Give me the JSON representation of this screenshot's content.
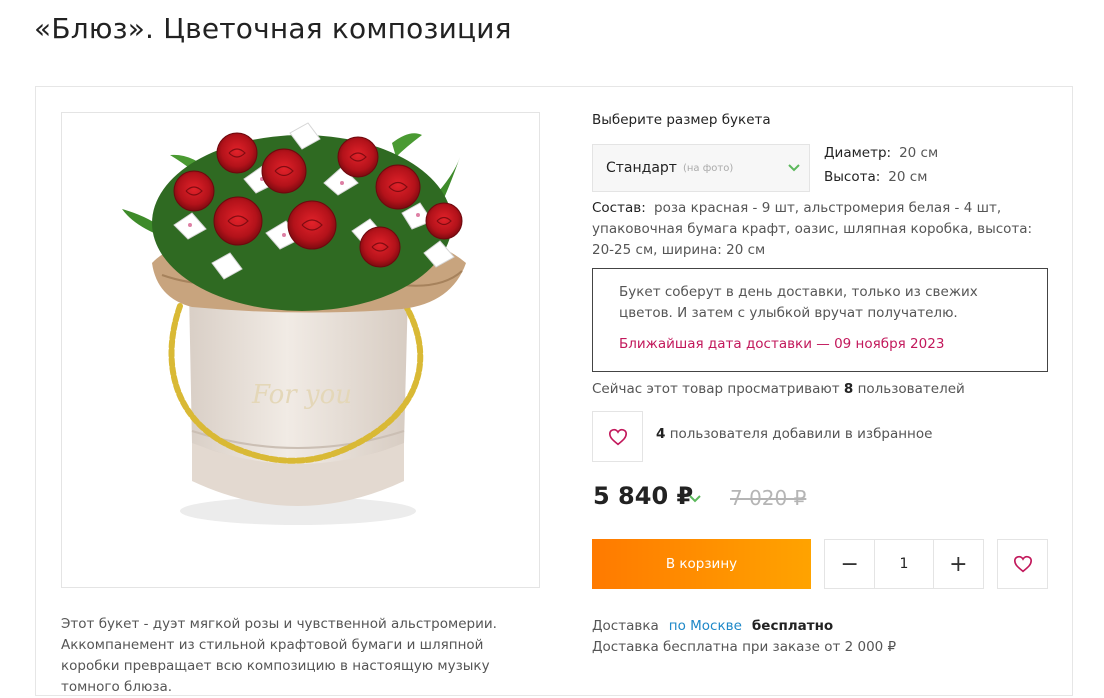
{
  "product": {
    "title": "«Блюз». Цветочная композиция",
    "description": "Этот букет - дуэт мягкой розы и чувственной альстромерии. Аккомпанемент из стильной крафтовой бумаги и шляпной коробки превращает всю композицию в настоящую музыку томного блюза.",
    "photo_lettering": "For you"
  },
  "size": {
    "title": "Выберите размер букета",
    "selected": "Стандарт",
    "note": "(на фото)",
    "diameter_label": "Диаметр:",
    "diameter_value": "20 см",
    "height_label": "Высота:",
    "height_value": "20 см"
  },
  "composition": {
    "label": "Состав:",
    "text": "роза красная - 9 шт, альстромерия белая - 4 шт, упаковочная бумага крафт, оазис, шляпная коробка, высота: 20-25 см, ширина: 20 см"
  },
  "info_box": {
    "text": "Букет соберут в день доставки, только из свежих цветов. И затем с улыбкой вручат получателю.",
    "delivery_date": "Ближайшая дата доставки — 09 ноября 2023"
  },
  "social": {
    "viewers_prefix": "Сейчас этот товар просматривают",
    "viewers_count": "8",
    "viewers_suffix": "пользователей",
    "favorites_count": "4",
    "favorites_text": "пользователя добавили в избранное"
  },
  "pricing": {
    "price": "5 840 ₽",
    "old_price": "7 020 ₽"
  },
  "cart": {
    "button_label": "В корзину",
    "quantity": "1",
    "minus": "−",
    "plus": "+"
  },
  "delivery": {
    "label": "Доставка",
    "city_link": "по Москве",
    "free": "бесплатно",
    "note": "Доставка бесплатна при заказе от 2 000 ₽"
  },
  "colors": {
    "accent_start": "#ff7a00",
    "accent_end": "#ffa300",
    "date_red": "#c2185b",
    "link_blue": "#1e88c8",
    "heart_red": "#c2185b",
    "chevron_green": "#5cb85c"
  },
  "icons": {
    "select_chevron": "chevron-down-icon",
    "price_chevron": "chevron-down-icon",
    "favorite": "heart-icon"
  }
}
